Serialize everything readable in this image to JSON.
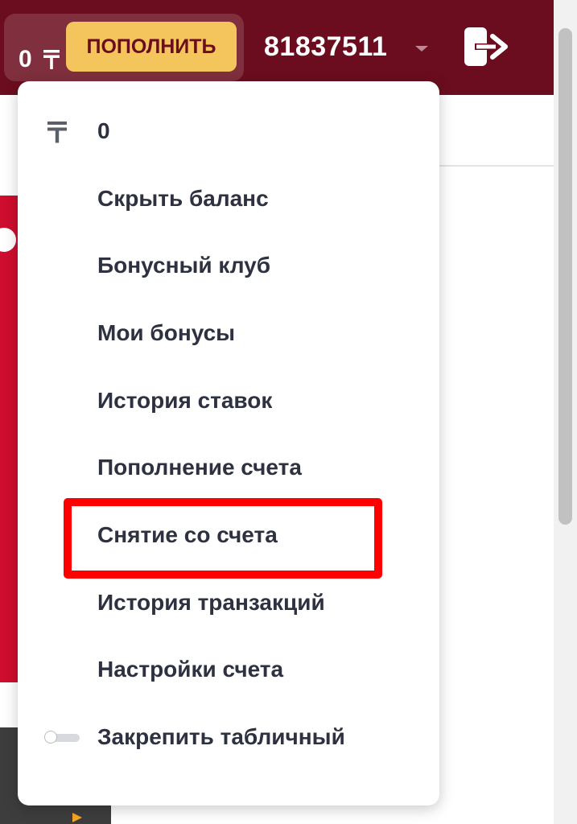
{
  "header": {
    "balance_amount": "0",
    "topup_label": "ПОПОЛНИТЬ",
    "account_number": "81837511",
    "background_color": "#6b0d1e",
    "topup_color": "#f5c55d",
    "currency_icon": "tenge-icon",
    "account_menu_icon": "chevron-down-icon",
    "logout_icon": "logout-icon"
  },
  "menu": {
    "balance_value": "0",
    "items": [
      {
        "label": "Скрыть баланс"
      },
      {
        "label": "Бонусный клуб"
      },
      {
        "label": "Мои бонусы"
      },
      {
        "label": "История ставок"
      },
      {
        "label": "Пополнение счета"
      },
      {
        "label": "Снятие со счета",
        "highlighted": true
      },
      {
        "label": "История транзакций"
      },
      {
        "label": "Настройки счета"
      }
    ],
    "pin_toggle_label": "Закрепить табличный",
    "pin_toggle_state": "off",
    "highlight_color": "#ff0000"
  }
}
